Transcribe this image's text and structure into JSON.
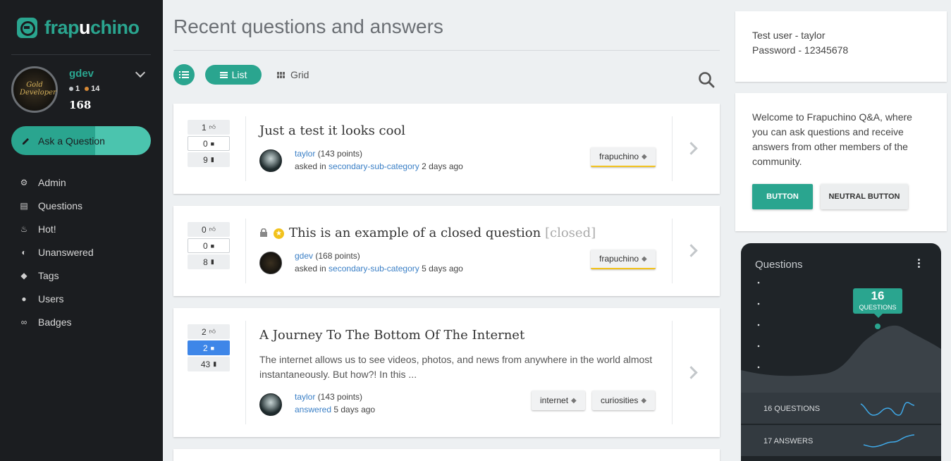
{
  "brand": {
    "name_a": "frap",
    "name_b": "u",
    "name_c": "chino"
  },
  "user": {
    "name": "gdev",
    "silver": "1",
    "bronze": "14",
    "points": "168",
    "avatar_text": "Gold Developer"
  },
  "ask_button": "Ask a Question",
  "nav": [
    {
      "label": "Admin",
      "icon": "gear-icon"
    },
    {
      "label": "Questions",
      "icon": "clipboard-icon"
    },
    {
      "label": "Hot!",
      "icon": "flame-icon"
    },
    {
      "label": "Unanswered",
      "icon": "half-circle-icon"
    },
    {
      "label": "Tags",
      "icon": "tag-icon"
    },
    {
      "label": "Users",
      "icon": "users-icon"
    },
    {
      "label": "Badges",
      "icon": "link-icon"
    }
  ],
  "main": {
    "title": "Recent questions and answers",
    "view_list": "List",
    "view_grid": "Grid"
  },
  "questions": [
    {
      "votes": "1",
      "answers": "0",
      "views": "9",
      "title": "Just a test it looks cool",
      "author": "taylor",
      "author_points": "(143 points)",
      "action": "asked in",
      "category": "secondary-sub-category",
      "when": "2 days ago",
      "tags": [
        "frapuchino"
      ]
    },
    {
      "votes": "0",
      "answers": "0",
      "views": "8",
      "title": "This is an example of a closed question",
      "closed_label": "[closed]",
      "author": "gdev",
      "author_points": "(168 points)",
      "action": "asked in",
      "category": "secondary-sub-category",
      "when": "5 days ago",
      "tags": [
        "frapuchino"
      ]
    },
    {
      "votes": "2",
      "answers": "2",
      "views": "43",
      "title": "A Journey To The Bottom Of The Internet",
      "excerpt": "The internet allows us to see videos, photos, and news from anywhere in the world almost instantaneously. But how?! In this ...",
      "author": "taylor",
      "author_points": "(143 points)",
      "action": "answered",
      "when": "5 days ago",
      "tags": [
        "internet",
        "curiosities"
      ]
    }
  ],
  "right": {
    "creds_line1": "Test user - taylor",
    "creds_line2": "Password - 12345678",
    "welcome": "Welcome to Frapuchino Q&A, where you can ask questions and receive answers from other members of the community.",
    "button": "BUTTON",
    "neutral_button": "NEUTRAL BUTTON"
  },
  "stats": {
    "title": "Questions",
    "bubble_number": "16",
    "bubble_label": "QUESTIONS",
    "row1": "16 QUESTIONS",
    "row2": "17 ANSWERS"
  },
  "colors": {
    "accent": "#2aa58f",
    "sidebar": "#1b1d20",
    "link": "#3a7fc6",
    "answer_badge": "#3e86e8",
    "tag_underline": "#f2c21c"
  }
}
